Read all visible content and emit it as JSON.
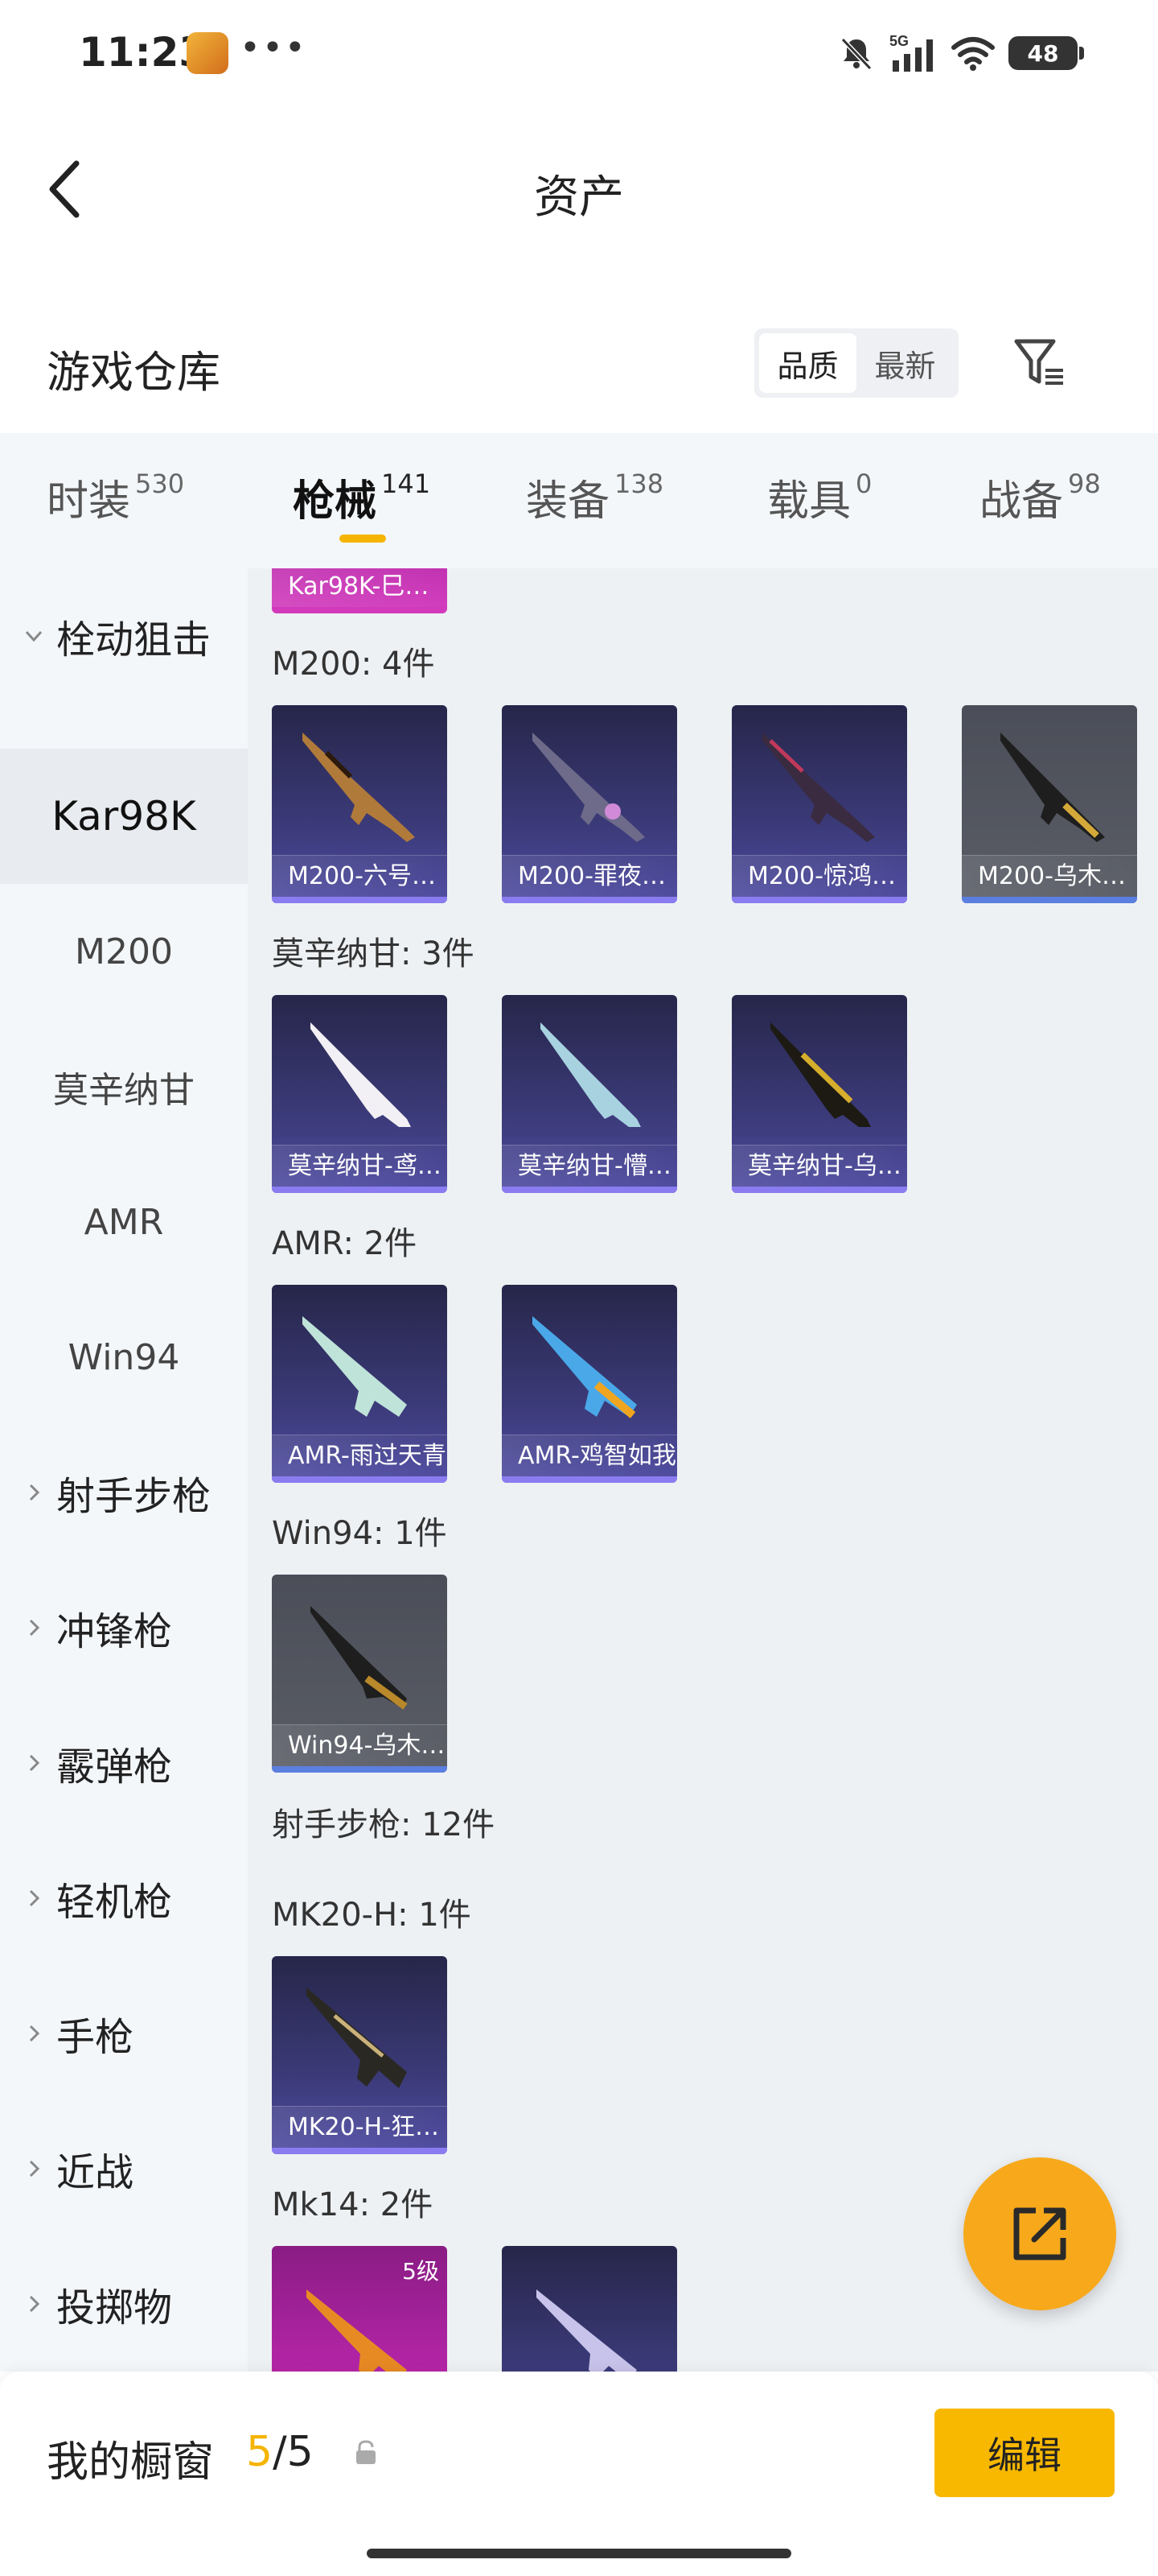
{
  "status_bar": {
    "time": "11:23",
    "dots": "•••",
    "network": "5G",
    "battery": "48",
    "icons": [
      "mute-icon",
      "signal-icon",
      "wifi-icon",
      "battery-icon"
    ]
  },
  "header": {
    "title": "资产",
    "back_icon": "chevron-left-icon"
  },
  "section": {
    "title": "游戏仓库",
    "sort_options": [
      "品质",
      "最新"
    ],
    "active_sort": "品质",
    "filter_icon": "filter-icon"
  },
  "category_tabs": [
    {
      "label": "时装",
      "count": "530"
    },
    {
      "label": "枪械",
      "count": "141"
    },
    {
      "label": "装备",
      "count": "138"
    },
    {
      "label": "载具",
      "count": "0"
    },
    {
      "label": "战备",
      "count": "98"
    }
  ],
  "active_tab": "枪械",
  "sidebar": [
    {
      "label": "栓动狙击",
      "type": "group",
      "expanded": true
    },
    {
      "label": "Kar98K",
      "type": "sub",
      "selected": true
    },
    {
      "label": "M200",
      "type": "sub"
    },
    {
      "label": "莫辛纳甘",
      "type": "sub"
    },
    {
      "label": "AMR",
      "type": "sub"
    },
    {
      "label": "Win94",
      "type": "sub"
    },
    {
      "label": "射手步枪",
      "type": "group"
    },
    {
      "label": "冲锋枪",
      "type": "group"
    },
    {
      "label": "霰弹枪",
      "type": "group"
    },
    {
      "label": "轻机枪",
      "type": "group"
    },
    {
      "label": "手枪",
      "type": "group"
    },
    {
      "label": "近战",
      "type": "group"
    },
    {
      "label": "投掷物",
      "type": "group"
    }
  ],
  "content": {
    "top_partial_item": "Kar98K-巳…",
    "groups": [
      {
        "label": "M200: 4件",
        "items": [
          "M200-六号…",
          "M200-罪夜…",
          "M200-惊鸿…",
          "M200-乌木…"
        ]
      },
      {
        "label": "莫辛纳甘: 3件",
        "items": [
          "莫辛纳甘-鸢…",
          "莫辛纳甘-懵…",
          "莫辛纳甘-乌…"
        ]
      },
      {
        "label": "AMR: 2件",
        "items": [
          "AMR-雨过天青",
          "AMR-鸡智如我"
        ]
      },
      {
        "label": "Win94: 1件",
        "items": [
          "Win94-乌木…"
        ]
      },
      {
        "label": "射手步枪: 12件",
        "items": []
      },
      {
        "label": "MK20-H: 1件",
        "items": [
          "MK20-H-狂…"
        ]
      },
      {
        "label": "Mk14: 2件",
        "items": [],
        "level_badge": "5级"
      }
    ]
  },
  "fab_icon": "share-external-icon",
  "bottom": {
    "showcase_label": "我的橱窗",
    "showcase_current": "5",
    "showcase_sep_total": "/5",
    "lock_icon": "lock-icon",
    "edit_label": "编辑"
  }
}
